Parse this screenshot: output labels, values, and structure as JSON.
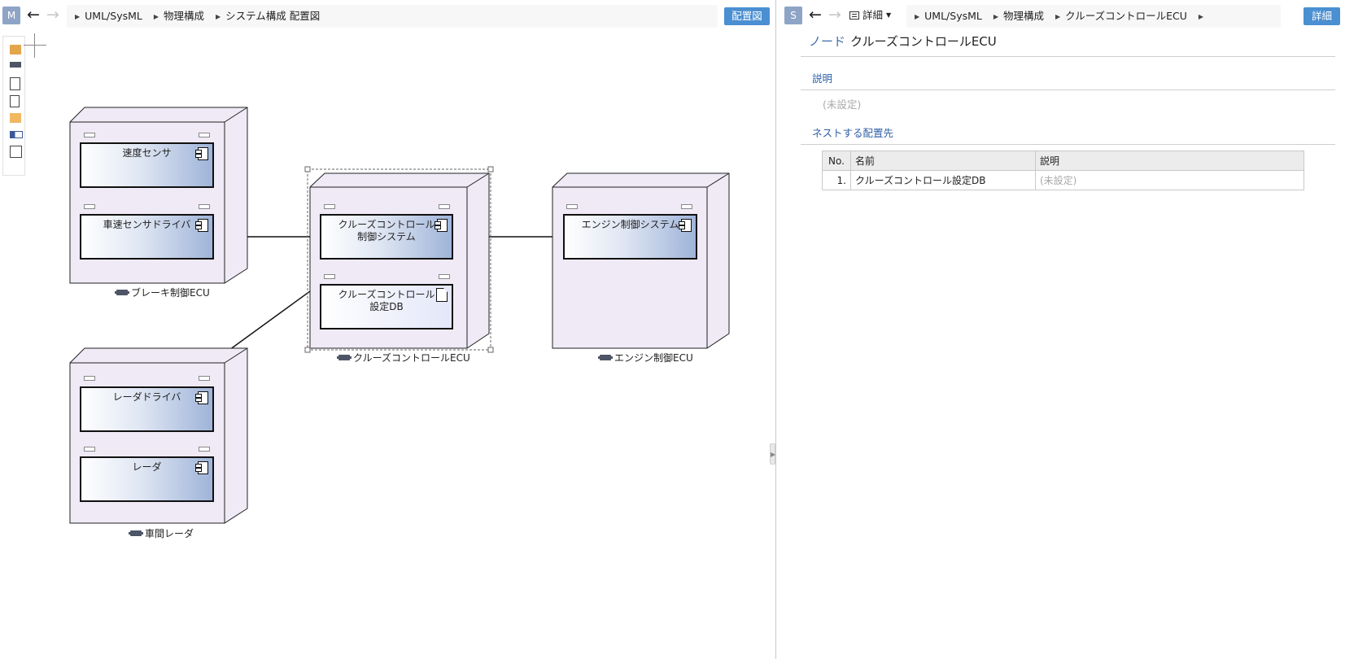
{
  "left": {
    "badge": "M",
    "breadcrumb": [
      "UML/SysML",
      "物理構成",
      "システム構成 配置図"
    ],
    "diagram_button": "配置図"
  },
  "right": {
    "badge": "S",
    "view_dropdown": "詳細",
    "breadcrumb": [
      "UML/SysML",
      "物理構成",
      "クルーズコントロールECU"
    ],
    "detail_button": "詳細",
    "kind": "ノード",
    "name": "クルーズコントロールECU",
    "description_header": "説明",
    "description_value": "(未設定)",
    "nested_header": "ネストする配置先",
    "table": {
      "columns": [
        "No.",
        "名前",
        "説明"
      ],
      "rows": [
        {
          "no": "1.",
          "name": "クルーズコントロール設定DB",
          "desc": "(未設定)"
        }
      ]
    }
  },
  "diagram": {
    "nodes": {
      "brake": "ブレーキ制御ECU",
      "cruise": "クルーズコントロールECU",
      "engine": "エンジン制御ECU",
      "radar": "車間レーダ"
    },
    "components": {
      "speed_sensor": "速度センサ",
      "wheel_sensor_driver": "車速センサドライバ",
      "cruise_system": "クルーズコントロール制御システム",
      "cruise_db": "クルーズコントロール設定DB",
      "engine_system": "エンジン制御システム",
      "radar_driver": "レーダドライバ",
      "radar": "レーダ"
    }
  },
  "colors": {
    "node_fill": "#efeaf6",
    "accent": "#4a8fd1",
    "section_text": "#2d5fa7"
  }
}
